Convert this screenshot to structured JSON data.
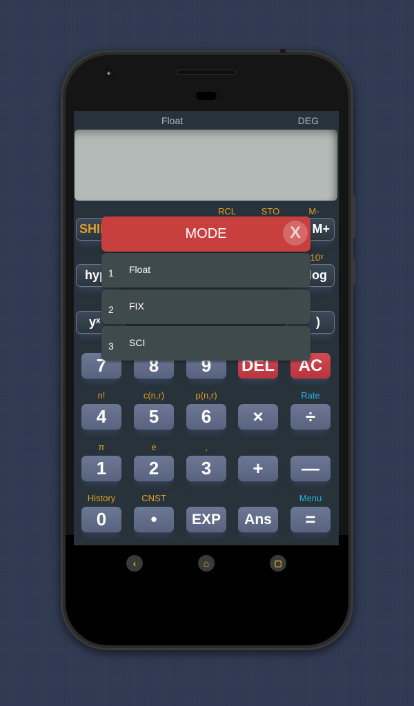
{
  "status": {
    "mode": "Float",
    "angle_unit": "DEG"
  },
  "display": {
    "value": ""
  },
  "top_labels": {
    "rcl": "RCL",
    "sto": "STO",
    "m_minus": "M-",
    "ten_x": "10ˣ"
  },
  "partial_keys": {
    "shift": "SHIFT",
    "m_plus": "M+",
    "hyp": "hyp",
    "log": "log",
    "yx": "yˣ",
    "rparen": ")"
  },
  "keypad": {
    "rows": [
      {
        "keys": [
          {
            "label": "7",
            "above": ""
          },
          {
            "label": "8",
            "above": ""
          },
          {
            "label": "9",
            "above": ""
          },
          {
            "label": "DEL",
            "above": "",
            "style": "red"
          },
          {
            "label": "AC",
            "above": "",
            "style": "red"
          }
        ]
      },
      {
        "keys": [
          {
            "label": "4",
            "above": "n!"
          },
          {
            "label": "5",
            "above": "c(n,r)"
          },
          {
            "label": "6",
            "above": "p(n,r)"
          },
          {
            "label": "×",
            "above": ""
          },
          {
            "label": "÷",
            "above": "Rate",
            "above_color": "blue"
          }
        ]
      },
      {
        "keys": [
          {
            "label": "1",
            "above": "π"
          },
          {
            "label": "2",
            "above": "e"
          },
          {
            "label": "3",
            "above": ","
          },
          {
            "label": "+",
            "above": ""
          },
          {
            "label": "—",
            "above": ""
          }
        ]
      },
      {
        "keys": [
          {
            "label": "0",
            "above": "History"
          },
          {
            "label": "•",
            "above": "CNST"
          },
          {
            "label": "EXP",
            "above": ""
          },
          {
            "label": "Ans",
            "above": ""
          },
          {
            "label": "=",
            "above": "Menu",
            "above_color": "blue"
          }
        ]
      }
    ]
  },
  "mode_dialog": {
    "title": "MODE",
    "close_icon": "close-icon",
    "close_glyph": "X",
    "items": [
      {
        "num": "1",
        "label": "Float"
      },
      {
        "num": "2",
        "label": "FIX"
      },
      {
        "num": "3",
        "label": "SCI"
      }
    ]
  },
  "navbar": {
    "back": "‹",
    "home": "⌂",
    "recents": "▢"
  },
  "colors": {
    "accent_orange": "#e0a127",
    "accent_blue": "#27b3e0",
    "dialog_header": "#c8403e",
    "key_red": "#c73e49"
  }
}
